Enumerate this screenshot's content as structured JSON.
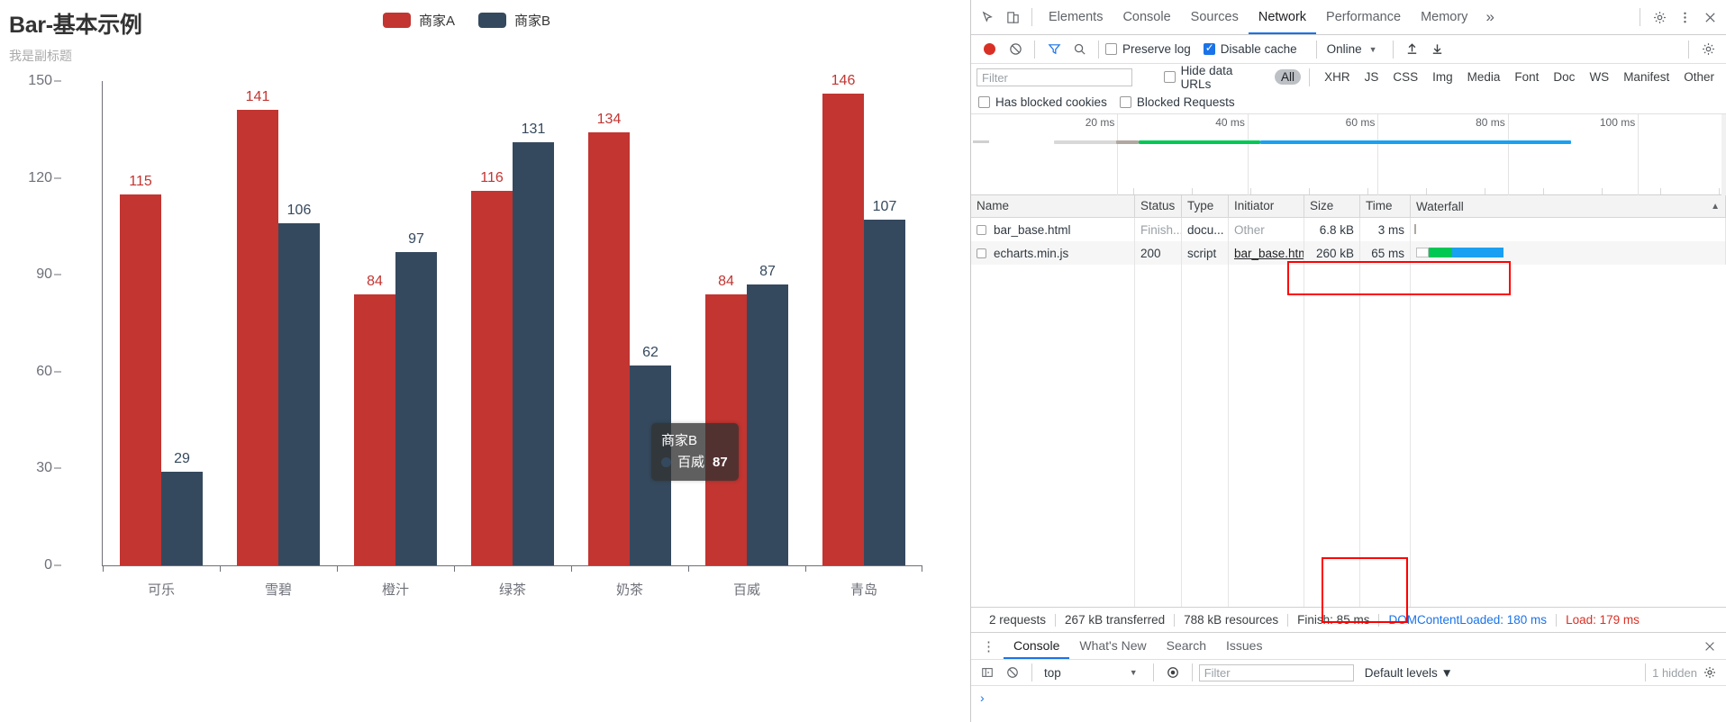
{
  "chart_data": {
    "type": "bar",
    "title": "Bar-基本示例",
    "subtitle": "我是副标题",
    "categories": [
      "可乐",
      "雪碧",
      "橙汁",
      "绿茶",
      "奶茶",
      "百威",
      "青岛"
    ],
    "series": [
      {
        "name": "商家A",
        "color": "#c23531",
        "values": [
          115,
          141,
          84,
          116,
          134,
          84,
          146
        ]
      },
      {
        "name": "商家B",
        "color": "#35495e",
        "values": [
          29,
          106,
          97,
          131,
          62,
          87,
          107
        ]
      }
    ],
    "xlabel": "",
    "ylabel": "",
    "ylim": [
      0,
      150
    ],
    "yticks": [
      0,
      30,
      60,
      90,
      120,
      150
    ],
    "grid": false,
    "legend_position": "top-center",
    "tooltip": {
      "title": "商家B",
      "series_name": "百威",
      "value": "87",
      "text": "百威: 87"
    }
  },
  "devtools": {
    "tabs": [
      {
        "label": "Elements",
        "active": false
      },
      {
        "label": "Console",
        "active": false
      },
      {
        "label": "Sources",
        "active": false
      },
      {
        "label": "Network",
        "active": true
      },
      {
        "label": "Performance",
        "active": false
      },
      {
        "label": "Memory",
        "active": false
      }
    ],
    "more_tabs": "»",
    "toolbar": {
      "preserve_log": "Preserve log",
      "disable_cache": "Disable cache",
      "throttle": "Online"
    },
    "filterbar": {
      "filter_placeholder": "Filter",
      "hide_data_urls": "Hide data URLs",
      "types": [
        "All",
        "XHR",
        "JS",
        "CSS",
        "Img",
        "Media",
        "Font",
        "Doc",
        "WS",
        "Manifest",
        "Other"
      ],
      "active_type": "All",
      "has_blocked_cookies": "Has blocked cookies",
      "blocked_requests": "Blocked Requests"
    },
    "overview": {
      "ticks": [
        "20 ms",
        "40 ms",
        "60 ms",
        "80 ms",
        "100 ms"
      ]
    },
    "table": {
      "columns": [
        "Name",
        "Status",
        "Type",
        "Initiator",
        "Size",
        "Time",
        "Waterfall"
      ],
      "rows": [
        {
          "name": "bar_base.html",
          "status": "Finish...",
          "type": "docu...",
          "initiator": "Other",
          "size": "6.8 kB",
          "time": "3 ms"
        },
        {
          "name": "echarts.min.js",
          "status": "200",
          "type": "script",
          "initiator": "bar_base.html",
          "size": "260 kB",
          "time": "65 ms"
        }
      ]
    },
    "summary": {
      "requests": "2 requests",
      "transferred": "267 kB transferred",
      "resources": "788 kB resources",
      "finish": "Finish: 85 ms",
      "dom_content_loaded": "DOMContentLoaded: 180 ms",
      "load": "Load: 179 ms"
    },
    "drawer": {
      "tabs": [
        {
          "label": "Console",
          "active": true
        },
        {
          "label": "What's New",
          "active": false
        },
        {
          "label": "Search",
          "active": false
        },
        {
          "label": "Issues",
          "active": false
        }
      ],
      "context": "top",
      "filter_placeholder": "Filter",
      "levels": "Default levels ▼",
      "hidden": "1 hidden",
      "prompt": "›"
    }
  }
}
